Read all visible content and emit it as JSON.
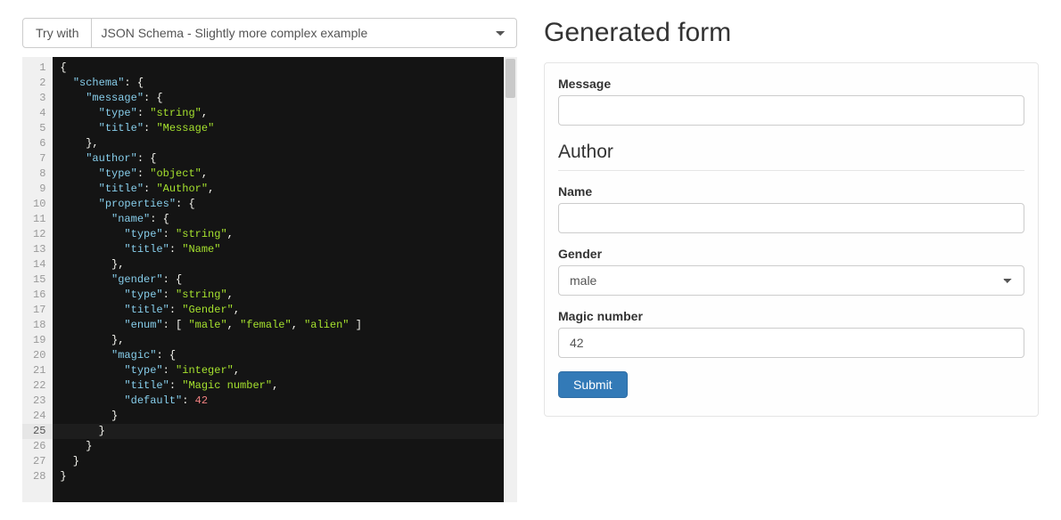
{
  "toolbar": {
    "trywith_label": "Try with",
    "select_value": "JSON Schema - Slightly more complex example"
  },
  "editor": {
    "active_line": 25,
    "lines": [
      {
        "n": 1,
        "tokens": [
          [
            "p",
            "{"
          ]
        ]
      },
      {
        "n": 2,
        "tokens": [
          [
            "p",
            "  "
          ],
          [
            "k",
            "\"schema\""
          ],
          [
            "p",
            ": {"
          ]
        ]
      },
      {
        "n": 3,
        "tokens": [
          [
            "p",
            "    "
          ],
          [
            "k",
            "\"message\""
          ],
          [
            "p",
            ": {"
          ]
        ]
      },
      {
        "n": 4,
        "tokens": [
          [
            "p",
            "      "
          ],
          [
            "k",
            "\"type\""
          ],
          [
            "p",
            ": "
          ],
          [
            "s",
            "\"string\""
          ],
          [
            "p",
            ","
          ]
        ]
      },
      {
        "n": 5,
        "tokens": [
          [
            "p",
            "      "
          ],
          [
            "k",
            "\"title\""
          ],
          [
            "p",
            ": "
          ],
          [
            "s",
            "\"Message\""
          ]
        ]
      },
      {
        "n": 6,
        "tokens": [
          [
            "p",
            "    },"
          ]
        ]
      },
      {
        "n": 7,
        "tokens": [
          [
            "p",
            "    "
          ],
          [
            "k",
            "\"author\""
          ],
          [
            "p",
            ": {"
          ]
        ]
      },
      {
        "n": 8,
        "tokens": [
          [
            "p",
            "      "
          ],
          [
            "k",
            "\"type\""
          ],
          [
            "p",
            ": "
          ],
          [
            "s",
            "\"object\""
          ],
          [
            "p",
            ","
          ]
        ]
      },
      {
        "n": 9,
        "tokens": [
          [
            "p",
            "      "
          ],
          [
            "k",
            "\"title\""
          ],
          [
            "p",
            ": "
          ],
          [
            "s",
            "\"Author\""
          ],
          [
            "p",
            ","
          ]
        ]
      },
      {
        "n": 10,
        "tokens": [
          [
            "p",
            "      "
          ],
          [
            "k",
            "\"properties\""
          ],
          [
            "p",
            ": {"
          ]
        ]
      },
      {
        "n": 11,
        "tokens": [
          [
            "p",
            "        "
          ],
          [
            "k",
            "\"name\""
          ],
          [
            "p",
            ": {"
          ]
        ]
      },
      {
        "n": 12,
        "tokens": [
          [
            "p",
            "          "
          ],
          [
            "k",
            "\"type\""
          ],
          [
            "p",
            ": "
          ],
          [
            "s",
            "\"string\""
          ],
          [
            "p",
            ","
          ]
        ]
      },
      {
        "n": 13,
        "tokens": [
          [
            "p",
            "          "
          ],
          [
            "k",
            "\"title\""
          ],
          [
            "p",
            ": "
          ],
          [
            "s",
            "\"Name\""
          ]
        ]
      },
      {
        "n": 14,
        "tokens": [
          [
            "p",
            "        },"
          ]
        ]
      },
      {
        "n": 15,
        "tokens": [
          [
            "p",
            "        "
          ],
          [
            "k",
            "\"gender\""
          ],
          [
            "p",
            ": {"
          ]
        ]
      },
      {
        "n": 16,
        "tokens": [
          [
            "p",
            "          "
          ],
          [
            "k",
            "\"type\""
          ],
          [
            "p",
            ": "
          ],
          [
            "s",
            "\"string\""
          ],
          [
            "p",
            ","
          ]
        ]
      },
      {
        "n": 17,
        "tokens": [
          [
            "p",
            "          "
          ],
          [
            "k",
            "\"title\""
          ],
          [
            "p",
            ": "
          ],
          [
            "s",
            "\"Gender\""
          ],
          [
            "p",
            ","
          ]
        ]
      },
      {
        "n": 18,
        "tokens": [
          [
            "p",
            "          "
          ],
          [
            "k",
            "\"enum\""
          ],
          [
            "p",
            ": [ "
          ],
          [
            "s",
            "\"male\""
          ],
          [
            "p",
            ", "
          ],
          [
            "s",
            "\"female\""
          ],
          [
            "p",
            ", "
          ],
          [
            "s",
            "\"alien\""
          ],
          [
            "p",
            " ]"
          ]
        ]
      },
      {
        "n": 19,
        "tokens": [
          [
            "p",
            "        },"
          ]
        ]
      },
      {
        "n": 20,
        "tokens": [
          [
            "p",
            "        "
          ],
          [
            "k",
            "\"magic\""
          ],
          [
            "p",
            ": {"
          ]
        ]
      },
      {
        "n": 21,
        "tokens": [
          [
            "p",
            "          "
          ],
          [
            "k",
            "\"type\""
          ],
          [
            "p",
            ": "
          ],
          [
            "s",
            "\"integer\""
          ],
          [
            "p",
            ","
          ]
        ]
      },
      {
        "n": 22,
        "tokens": [
          [
            "p",
            "          "
          ],
          [
            "k",
            "\"title\""
          ],
          [
            "p",
            ": "
          ],
          [
            "s",
            "\"Magic number\""
          ],
          [
            "p",
            ","
          ]
        ]
      },
      {
        "n": 23,
        "tokens": [
          [
            "p",
            "          "
          ],
          [
            "k",
            "\"default\""
          ],
          [
            "p",
            ": "
          ],
          [
            "n",
            "42"
          ]
        ]
      },
      {
        "n": 24,
        "tokens": [
          [
            "p",
            "        }"
          ]
        ]
      },
      {
        "n": 25,
        "tokens": [
          [
            "p",
            "      }"
          ]
        ]
      },
      {
        "n": 26,
        "tokens": [
          [
            "p",
            "    }"
          ]
        ]
      },
      {
        "n": 27,
        "tokens": [
          [
            "p",
            "  }"
          ]
        ]
      },
      {
        "n": 28,
        "tokens": [
          [
            "p",
            "}"
          ]
        ]
      }
    ]
  },
  "form": {
    "title": "Generated form",
    "message_label": "Message",
    "message_value": "",
    "author_legend": "Author",
    "name_label": "Name",
    "name_value": "",
    "gender_label": "Gender",
    "gender_value": "male",
    "magic_label": "Magic number",
    "magic_value": "42",
    "submit_label": "Submit"
  }
}
